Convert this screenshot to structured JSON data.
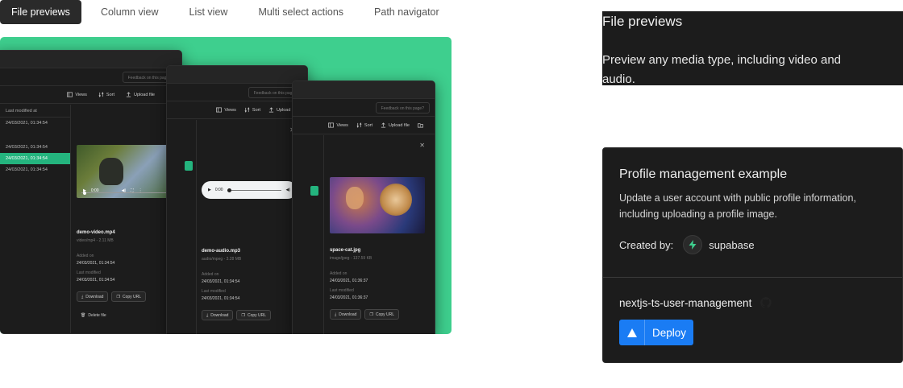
{
  "tabs": [
    {
      "label": "File previews"
    },
    {
      "label": "Column view"
    },
    {
      "label": "List view"
    },
    {
      "label": "Multi select actions"
    },
    {
      "label": "Path navigator"
    }
  ],
  "preview": {
    "accent": "#3ecf8e",
    "feedback_label": "Feedback on this page?",
    "toolbar": {
      "views": "Views",
      "sort": "Sort",
      "upload": "Upload file"
    },
    "list_header": "Last modified at",
    "list_rows": [
      "24/03/2021, 01:34:54",
      "24/03/2021, 01:34:54",
      "24/03/2021, 01:34:54",
      "24/03/2021, 01:34:54"
    ],
    "video": {
      "name": "demo-video.mp4",
      "meta": "video/mp4 - 2.11 MB",
      "time": "0:00",
      "added_label": "Added on",
      "added": "24/03/2021, 01:34:54",
      "modified_label": "Last modified",
      "modified": "24/03/2021, 01:34:54",
      "download": "Download",
      "copy": "Copy URL",
      "delete": "Delete file"
    },
    "audio": {
      "name": "demo-audio.mp3",
      "meta": "audio/mpeg - 3.28 MB",
      "time": "0:00",
      "added_label": "Added on",
      "added": "24/03/2021, 01:34:54",
      "modified_label": "Last modified",
      "modified": "24/03/2021, 01:34:54",
      "download": "Download",
      "copy": "Copy URL"
    },
    "image": {
      "name": "space-cat.jpg",
      "meta": "image/jpeg - 137.59 KB",
      "added_label": "Added on",
      "added": "24/03/2021, 01:36:37",
      "modified_label": "Last modified",
      "modified": "24/03/2021, 01:36:37",
      "download": "Download",
      "copy": "Copy URL"
    }
  },
  "feature_card": {
    "title": "File previews",
    "description": "Preview any media type, including video and audio."
  },
  "example_card": {
    "title": "Profile management example",
    "description": "Update a user account with public profile information, including uploading a profile image.",
    "created_by_label": "Created by:",
    "author": "supabase",
    "repo": "nextjs-ts-user-management",
    "deploy_label": "Deploy",
    "deploy_color": "#1a7cf4"
  }
}
